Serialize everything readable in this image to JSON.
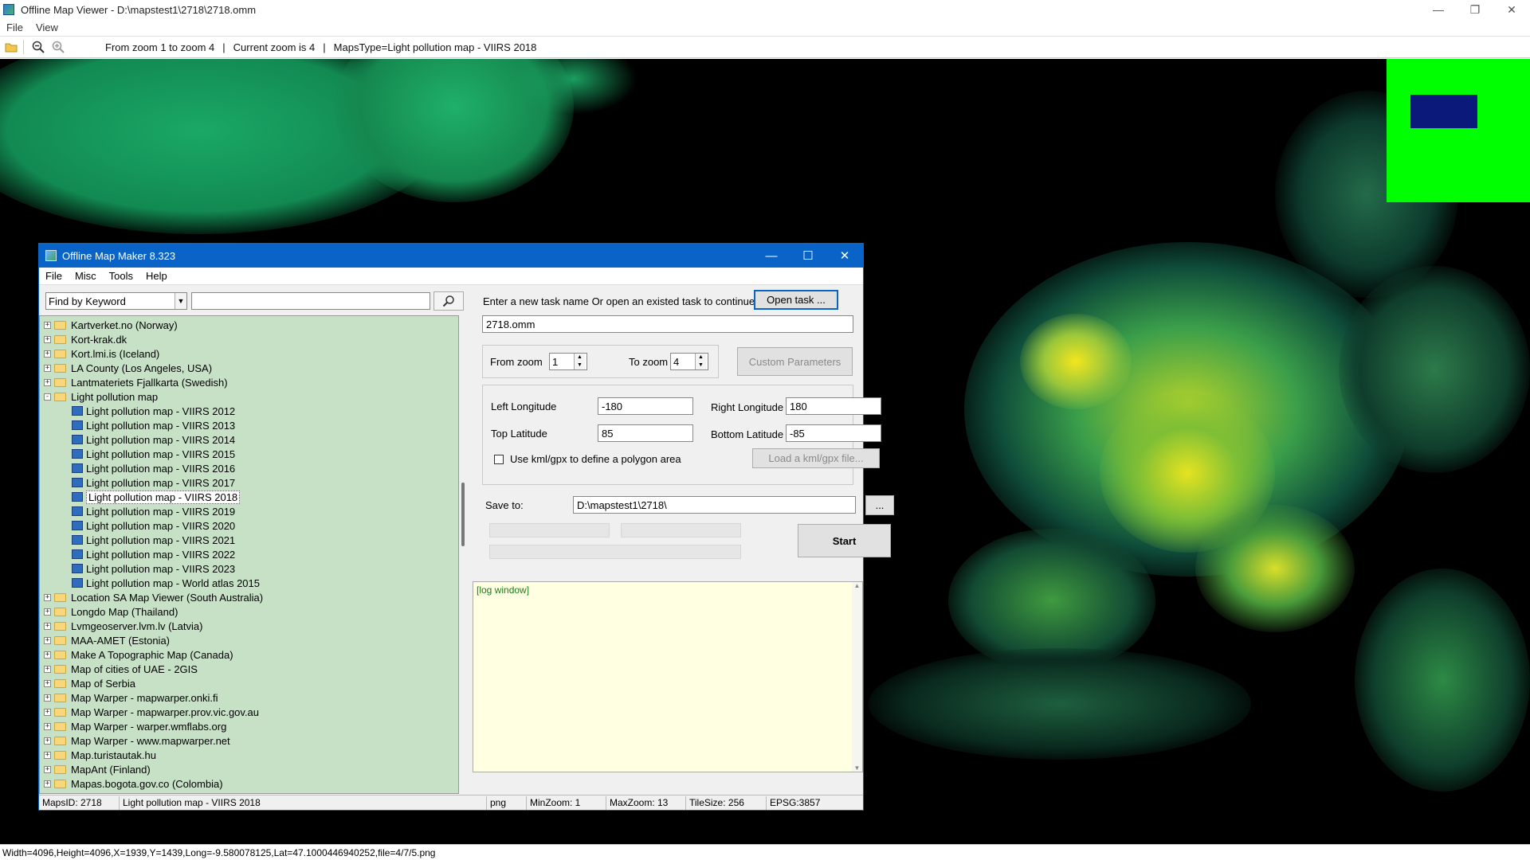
{
  "viewer": {
    "title": "Offline Map Viewer - D:\\mapstest1\\2718\\2718.omm",
    "menu": [
      "File",
      "View"
    ],
    "toolbar_info": {
      "zoom_range": "From zoom 1 to zoom 4",
      "current_zoom": "Current zoom is 4",
      "maps_type": "MapsType=Light pollution map - VIIRS 2018"
    },
    "status": "Width=4096,Height=4096,X=1939,Y=1439,Long=-9.580078125,Lat=47.1000446940252,file=4/7/5.png"
  },
  "dialog": {
    "title": "Offline Map Maker 8.323",
    "menu": [
      "File",
      "Misc",
      "Tools",
      "Help"
    ],
    "search": {
      "mode": "Find by Keyword",
      "query": ""
    },
    "tree": [
      {
        "label": "Kartverket.no (Norway)",
        "type": "folder"
      },
      {
        "label": "Kort-krak.dk",
        "type": "folder"
      },
      {
        "label": "Kort.lmi.is (Iceland)",
        "type": "folder"
      },
      {
        "label": "LA County (Los Angeles, USA)",
        "type": "folder"
      },
      {
        "label": "Lantmateriets Fjallkarta (Swedish)",
        "type": "folder"
      },
      {
        "label": "Light pollution map",
        "type": "folder-open"
      },
      {
        "label": "Light pollution map - VIIRS 2012",
        "type": "leaf"
      },
      {
        "label": "Light pollution map - VIIRS 2013",
        "type": "leaf"
      },
      {
        "label": "Light pollution map - VIIRS 2014",
        "type": "leaf"
      },
      {
        "label": "Light pollution map - VIIRS 2015",
        "type": "leaf"
      },
      {
        "label": "Light pollution map - VIIRS 2016",
        "type": "leaf"
      },
      {
        "label": "Light pollution map - VIIRS 2017",
        "type": "leaf"
      },
      {
        "label": "Light pollution map - VIIRS 2018",
        "type": "leaf",
        "selected": true
      },
      {
        "label": "Light pollution map - VIIRS 2019",
        "type": "leaf"
      },
      {
        "label": "Light pollution map - VIIRS 2020",
        "type": "leaf"
      },
      {
        "label": "Light pollution map - VIIRS 2021",
        "type": "leaf"
      },
      {
        "label": "Light pollution map - VIIRS 2022",
        "type": "leaf"
      },
      {
        "label": "Light pollution map - VIIRS 2023",
        "type": "leaf"
      },
      {
        "label": "Light pollution map - World atlas 2015",
        "type": "leaf"
      },
      {
        "label": "Location SA Map Viewer (South Australia)",
        "type": "folder"
      },
      {
        "label": "Longdo Map (Thailand)",
        "type": "folder"
      },
      {
        "label": "Lvmgeoserver.lvm.lv (Latvia)",
        "type": "folder"
      },
      {
        "label": "MAA-AMET (Estonia)",
        "type": "folder"
      },
      {
        "label": "Make A Topographic Map (Canada)",
        "type": "folder"
      },
      {
        "label": "Map of cities of UAE - 2GIS",
        "type": "folder"
      },
      {
        "label": "Map of Serbia",
        "type": "folder"
      },
      {
        "label": "Map Warper - mapwarper.onki.fi",
        "type": "folder"
      },
      {
        "label": "Map Warper - mapwarper.prov.vic.gov.au",
        "type": "folder"
      },
      {
        "label": "Map Warper - warper.wmflabs.org",
        "type": "folder"
      },
      {
        "label": "Map Warper - www.mapwarper.net",
        "type": "folder"
      },
      {
        "label": "Map.turistautak.hu",
        "type": "folder"
      },
      {
        "label": "MapAnt (Finland)",
        "type": "folder"
      },
      {
        "label": "Mapas.bogota.gov.co (Colombia)",
        "type": "folder"
      }
    ],
    "task": {
      "prompt": "Enter a new task name Or open an existed task to continue:",
      "open_button": "Open task ...",
      "name": "2718.omm"
    },
    "zoom": {
      "from_label": "From zoom",
      "from_value": "1",
      "to_label": "To zoom",
      "to_value": "4",
      "custom_button": "Custom Parameters"
    },
    "bounds": {
      "left_label": "Left Longitude",
      "left_value": "-180",
      "right_label": "Right Longitude",
      "right_value": "180",
      "top_label": "Top Latitude",
      "top_value": "85",
      "bottom_label": "Bottom Latitude",
      "bottom_value": "-85",
      "kml_label": "Use kml/gpx to define a polygon area",
      "kml_button": "Load a kml/gpx file..."
    },
    "save": {
      "label": "Save to:",
      "path": "D:\\mapstest1\\2718\\",
      "browse": "...",
      "start": "Start"
    },
    "log": "[log window]",
    "status": {
      "maps_id": "MapsID: 2718",
      "name": "Light pollution map - VIIRS 2018",
      "format": "png",
      "min_zoom": "MinZoom: 1",
      "max_zoom": "MaxZoom: 13",
      "tile_size": "TileSize: 256",
      "epsg": "EPSG:3857"
    }
  },
  "colors": {
    "accent": "#0a64c8",
    "tree_bg": "#c7e1c7",
    "log_bg": "#ffffe1",
    "minimap": "#00ff00"
  }
}
